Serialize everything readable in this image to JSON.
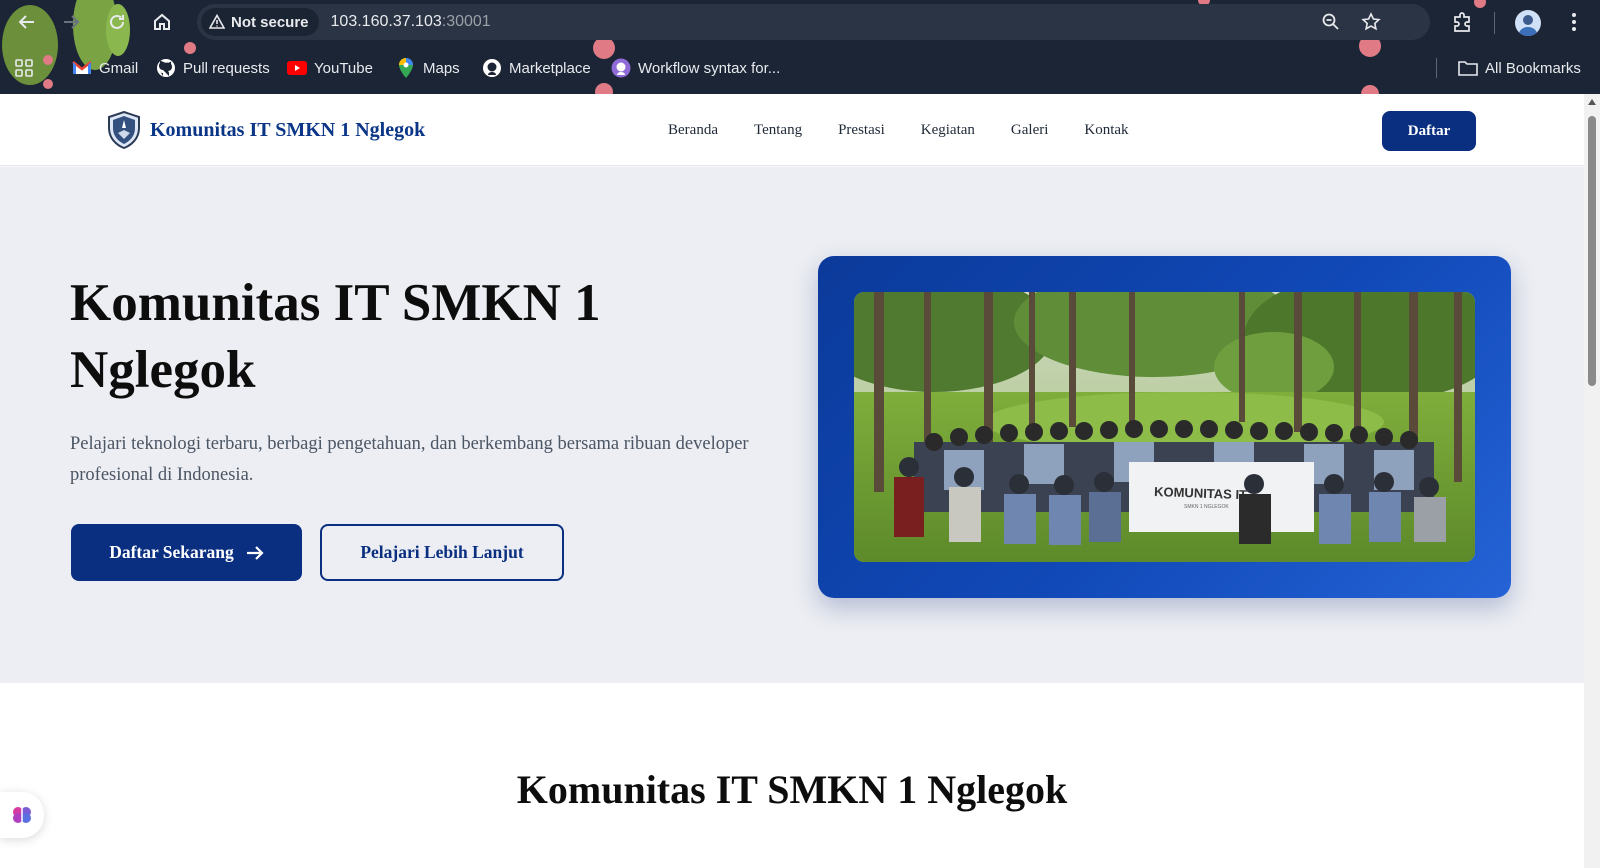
{
  "browser": {
    "security_label": "Not secure",
    "url_host": "103.160.37.103",
    "url_port": ":30001",
    "bookmarks": [
      {
        "label": "Gmail",
        "icon": "gmail-icon"
      },
      {
        "label": "Pull requests",
        "icon": "github-icon"
      },
      {
        "label": "YouTube",
        "icon": "youtube-icon"
      },
      {
        "label": "Maps",
        "icon": "maps-icon"
      },
      {
        "label": "Marketplace",
        "icon": "github-icon"
      },
      {
        "label": "Workflow syntax for...",
        "icon": "github-icon"
      }
    ],
    "all_bookmarks": "All Bookmarks"
  },
  "site": {
    "brand": "Komunitas IT SMKN 1 Nglegok",
    "menu": [
      "Beranda",
      "Tentang",
      "Prestasi",
      "Kegiatan",
      "Galeri",
      "Kontak"
    ],
    "cta": "Daftar"
  },
  "hero": {
    "title": "Komunitas IT SMKN 1 Nglegok",
    "description": "Pelajari teknologi terbaru, berbagi pengetahuan, dan berkembang bersama ribuan developer profesional di Indonesia.",
    "primary_button": "Daftar Sekarang",
    "secondary_button": "Pelajari Lebih Lanjut",
    "banner_text": "KOMUNITAS IT",
    "banner_subtext": "SMKN 1 NGLEGOK"
  },
  "section": {
    "title": "Komunitas IT SMKN 1 Nglegok"
  },
  "colors": {
    "primary": "#0a2f80",
    "chrome_bg": "#1b2536",
    "hero_bg": "#eceef3"
  }
}
